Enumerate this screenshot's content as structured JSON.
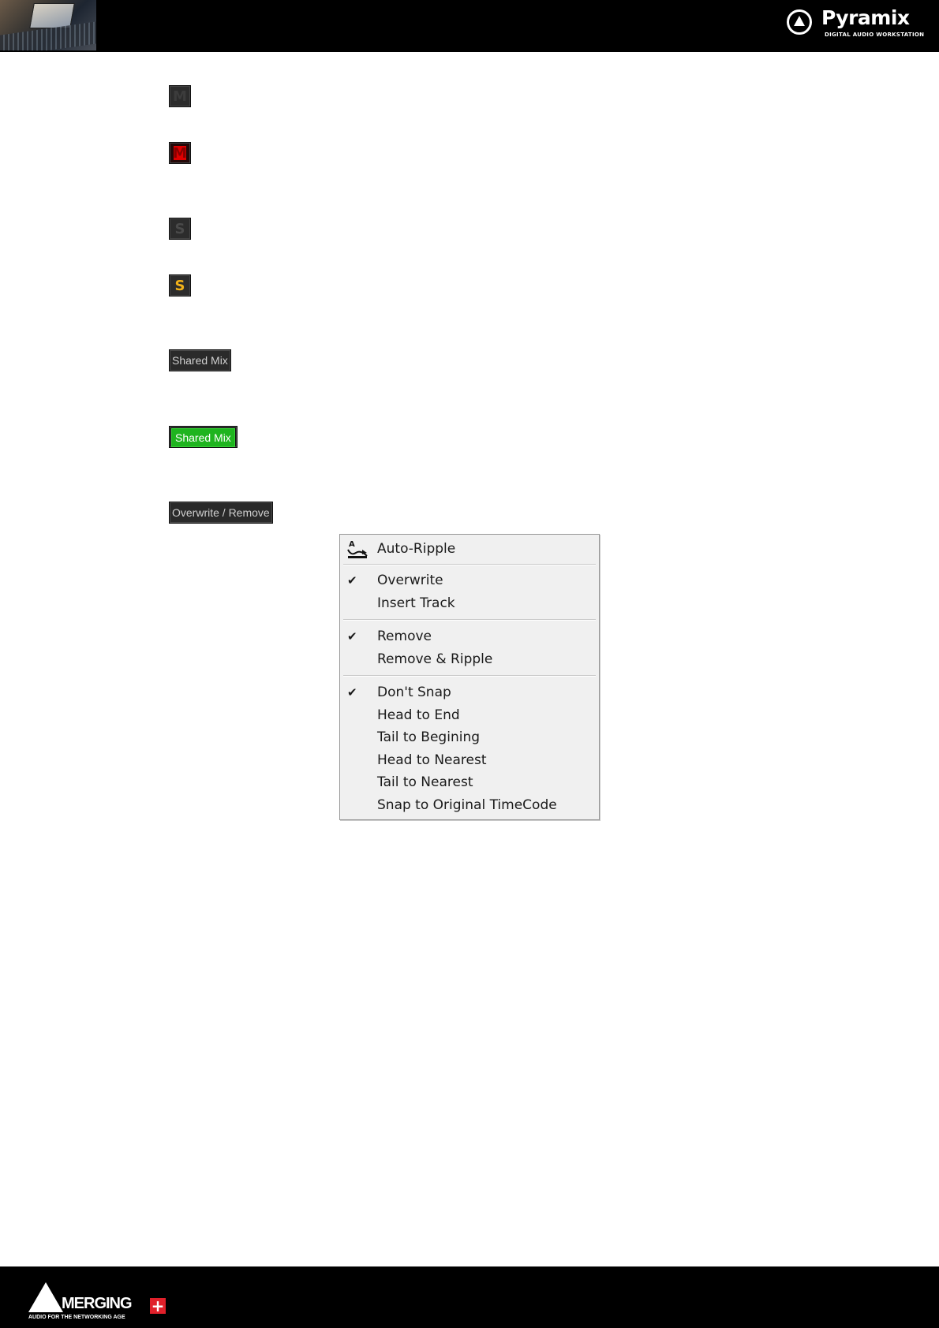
{
  "header": {
    "brand_name": "Pyramix",
    "brand_subtitle": "DIGITAL AUDIO WORKSTATION"
  },
  "buttons": {
    "mute_off_label": "M",
    "mute_on_label": "M",
    "solo_off_label": "S",
    "solo_on_label": "S",
    "shared_mix_off_label": "Shared Mix",
    "shared_mix_on_label": "Shared Mix",
    "overwrite_remove_label": "Overwrite / Remove"
  },
  "colors": {
    "mute_on": "#e00000",
    "solo_on": "#f2b21a",
    "shared_mix_on": "#1fb41f"
  },
  "menu": {
    "auto_ripple": "Auto-Ripple",
    "groups": [
      [
        {
          "label": "Overwrite",
          "checked": true
        },
        {
          "label": "Insert Track",
          "checked": false
        }
      ],
      [
        {
          "label": "Remove",
          "checked": true
        },
        {
          "label": "Remove & Ripple",
          "checked": false
        }
      ],
      [
        {
          "label": "Don't Snap",
          "checked": true
        },
        {
          "label": "Head to End",
          "checked": false
        },
        {
          "label": "Tail to Begining",
          "checked": false
        },
        {
          "label": "Head to Nearest",
          "checked": false
        },
        {
          "label": "Tail to Nearest",
          "checked": false
        },
        {
          "label": "Snap to Original TimeCode",
          "checked": false
        }
      ]
    ],
    "check_glyph": "✔"
  },
  "footer": {
    "brand_name": "MERGING",
    "plus_glyph": "+",
    "tagline": "AUDIO FOR THE NETWORKING AGE"
  }
}
